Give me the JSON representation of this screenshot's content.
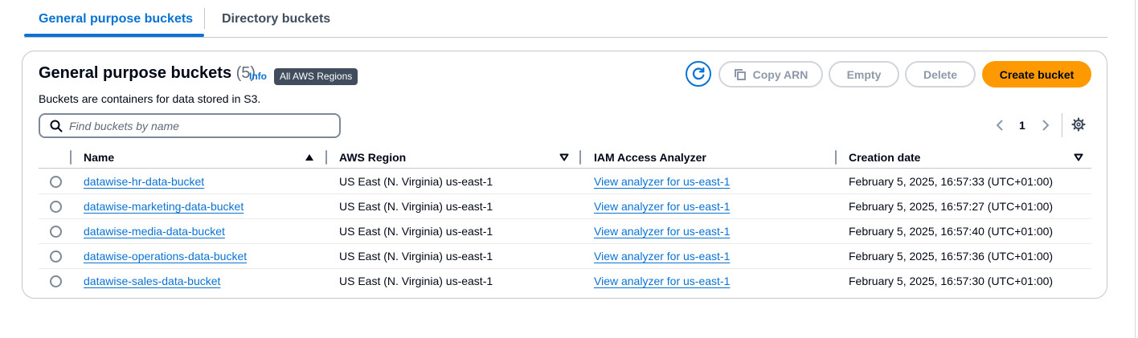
{
  "tabs": [
    {
      "label": "General purpose buckets",
      "active": true
    },
    {
      "label": "Directory buckets",
      "active": false
    }
  ],
  "panel": {
    "title": "General purpose buckets",
    "count": "(5)",
    "info_label": "Info",
    "region_badge": "All AWS Regions",
    "description": "Buckets are containers for data stored in S3."
  },
  "actions": {
    "refresh_icon": "refresh-icon",
    "copy_arn_label": "Copy ARN",
    "empty_label": "Empty",
    "delete_label": "Delete",
    "create_label": "Create bucket"
  },
  "search": {
    "placeholder": "Find buckets by name",
    "value": ""
  },
  "pagination": {
    "current_page": "1"
  },
  "table": {
    "columns": [
      "Name",
      "AWS Region",
      "IAM Access Analyzer",
      "Creation date"
    ],
    "sorted_column": "Name",
    "sort_direction": "ascending",
    "rows": [
      {
        "name": "datawise-hr-data-bucket",
        "region": "US East (N. Virginia) us-east-1",
        "analyzer": "View analyzer for us-east-1",
        "created": "February 5, 2025, 16:57:33 (UTC+01:00)"
      },
      {
        "name": "datawise-marketing-data-bucket",
        "region": "US East (N. Virginia) us-east-1",
        "analyzer": "View analyzer for us-east-1",
        "created": "February 5, 2025, 16:57:27 (UTC+01:00)"
      },
      {
        "name": "datawise-media-data-bucket",
        "region": "US East (N. Virginia) us-east-1",
        "analyzer": "View analyzer for us-east-1",
        "created": "February 5, 2025, 16:57:40 (UTC+01:00)"
      },
      {
        "name": "datawise-operations-data-bucket",
        "region": "US East (N. Virginia) us-east-1",
        "analyzer": "View analyzer for us-east-1",
        "created": "February 5, 2025, 16:57:36 (UTC+01:00)"
      },
      {
        "name": "datawise-sales-data-bucket",
        "region": "US East (N. Virginia) us-east-1",
        "analyzer": "View analyzer for us-east-1",
        "created": "February 5, 2025, 16:57:30 (UTC+01:00)"
      }
    ]
  },
  "colors": {
    "accent": "#0972d3",
    "primary_button": "#ff9900",
    "badge": "#414d5c"
  }
}
